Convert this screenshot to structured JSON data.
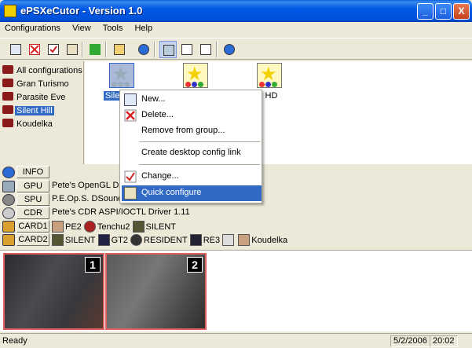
{
  "window": {
    "title": "ePSXeCutor - Version 1.0",
    "minimize": "_",
    "maximize": "□",
    "close": "X"
  },
  "menubar": [
    "Configurations",
    "View",
    "Tools",
    "Help"
  ],
  "toolbar_icons": [
    "new-config-icon",
    "delete-config-icon",
    "check-icon",
    "quick-configure-icon",
    "run-icon",
    "open-folder-icon",
    "info-icon",
    "large-icons-view-icon",
    "details-view-icon",
    "list-view-icon",
    "help-icon"
  ],
  "tree": {
    "items": [
      {
        "label": "All configurations",
        "selected": false
      },
      {
        "label": "Gran Turismo",
        "selected": false
      },
      {
        "label": "Parasite Eve",
        "selected": false
      },
      {
        "label": "Silent Hill",
        "selected": true
      },
      {
        "label": "Koudelka",
        "selected": false
      }
    ]
  },
  "configs": [
    {
      "label": "Silen",
      "selected": true
    },
    {
      "label": "",
      "selected": false
    },
    {
      "label": "l HD",
      "selected": false
    }
  ],
  "context_menu": {
    "items": [
      {
        "label": "New...",
        "icon": "new-icon"
      },
      {
        "label": "Delete...",
        "icon": "delete-icon"
      },
      {
        "label": "Remove from group...",
        "icon": ""
      },
      {
        "label": "Create desktop config link",
        "icon": ""
      },
      {
        "label": "Change...",
        "icon": "check-icon"
      },
      {
        "label": "Quick configure",
        "icon": "magnifier-icon",
        "highlighted": true
      }
    ]
  },
  "plugins": {
    "info": {
      "button": "INFO",
      "value": ""
    },
    "gpu": {
      "button": "GPU",
      "value": "Pete's OpenGL Dr"
    },
    "spu": {
      "button": "SPU",
      "value": "P.E.Op.S. DSound"
    },
    "cdr": {
      "button": "CDR",
      "value": "Pete's CDR ASPI/IOCTL Driver 1.11"
    },
    "card1": {
      "button": "CARD1",
      "saves": [
        "PE2",
        "Tenchu2",
        "SILENT"
      ]
    },
    "card2": {
      "button": "CARD2",
      "saves": [
        "SILENT",
        "GT2",
        "RESIDENT",
        "RE3",
        "Koudelka"
      ]
    }
  },
  "screenshots": [
    {
      "number": "1"
    },
    {
      "number": "2"
    }
  ],
  "status": {
    "text": "Ready",
    "date": "5/2/2006",
    "time": "20:02"
  },
  "colors": {
    "titlebar": "#0058e6",
    "selection": "#316ac5",
    "screenshot_border": "#e06060"
  }
}
